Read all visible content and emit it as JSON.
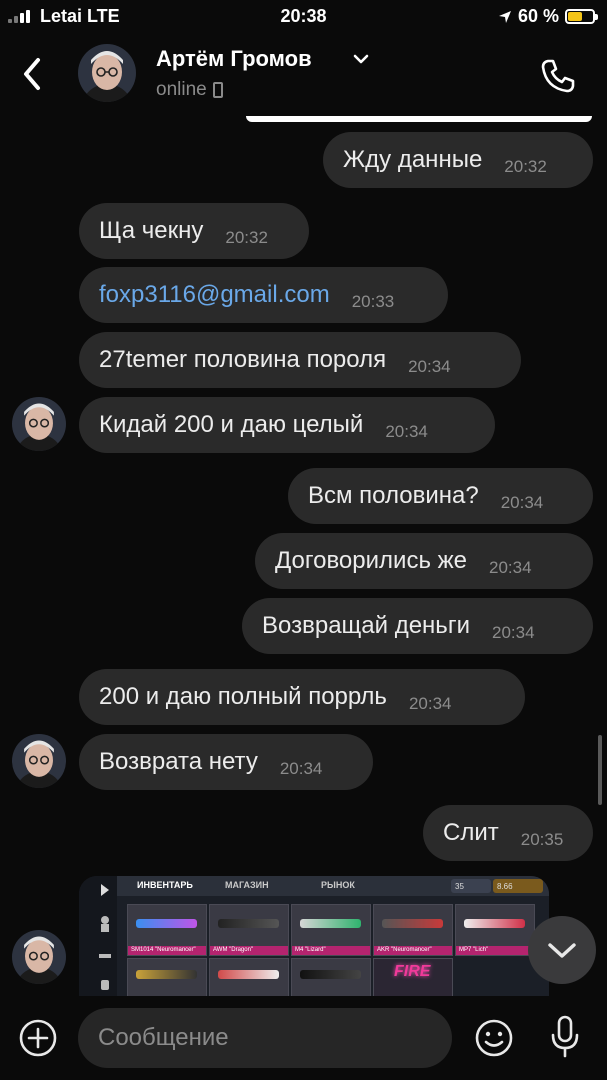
{
  "status_bar": {
    "carrier": "Letai  LTE",
    "time": "20:38",
    "battery": "60 %",
    "battery_level": 0.6
  },
  "header": {
    "name": "Артём Громов",
    "status": "online"
  },
  "messages": [
    {
      "text": "Жду данные",
      "time": "20:32",
      "side": "out"
    },
    {
      "text": "Ща чекну",
      "time": "20:32",
      "side": "in"
    },
    {
      "text": "foxp3116@gmail.com",
      "time": "20:33",
      "side": "in",
      "link": true
    },
    {
      "text": "27temer половина пороля",
      "time": "20:34",
      "side": "in"
    },
    {
      "text": "Кидай 200 и даю целый",
      "time": "20:34",
      "side": "in"
    },
    {
      "text": "Всм половина?",
      "time": "20:34",
      "side": "out"
    },
    {
      "text": "Договорились же",
      "time": "20:34",
      "side": "out"
    },
    {
      "text": "Возвращай деньги",
      "time": "20:34",
      "side": "out"
    },
    {
      "text": "200 и даю полный поррль",
      "time": "20:34",
      "side": "in"
    },
    {
      "text": "Возврата нету",
      "time": "20:34",
      "side": "in"
    },
    {
      "text": "Слит",
      "time": "20:35",
      "side": "out"
    }
  ],
  "attachment": {
    "tabs": [
      "ИНВЕНТАРЬ",
      "МАГАЗИН",
      "РЫНОК"
    ],
    "currency": [
      "35",
      "8.66"
    ],
    "items": [
      "SM1014 \"Neuromancer\"",
      "AWM \"Dragon\"",
      "M4 \"Lizard\"",
      "AKR \"Neuromancer\"",
      "MP7 \"Lich\""
    ],
    "fire_text": "FIRE"
  },
  "input": {
    "placeholder": "Сообщение"
  },
  "colors": {
    "background": "#0a0a0a",
    "bubble": "#2a2a2a",
    "link": "#6aa8e8",
    "battery": "#f5c518"
  }
}
